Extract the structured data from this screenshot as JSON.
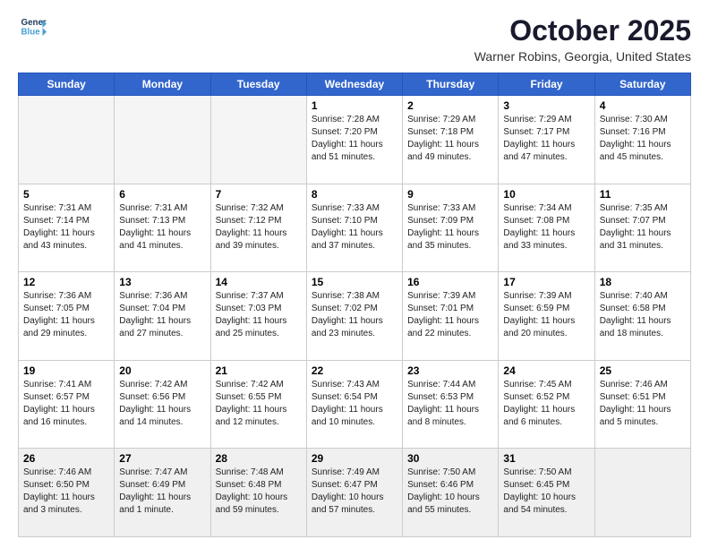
{
  "logo": {
    "line1": "General",
    "line2": "Blue"
  },
  "header": {
    "month": "October 2025",
    "location": "Warner Robins, Georgia, United States"
  },
  "weekdays": [
    "Sunday",
    "Monday",
    "Tuesday",
    "Wednesday",
    "Thursday",
    "Friday",
    "Saturday"
  ],
  "weeks": [
    [
      {
        "day": "",
        "sunrise": "",
        "sunset": "",
        "daylight": ""
      },
      {
        "day": "",
        "sunrise": "",
        "sunset": "",
        "daylight": ""
      },
      {
        "day": "",
        "sunrise": "",
        "sunset": "",
        "daylight": ""
      },
      {
        "day": "1",
        "sunrise": "Sunrise: 7:28 AM",
        "sunset": "Sunset: 7:20 PM",
        "daylight": "Daylight: 11 hours and 51 minutes."
      },
      {
        "day": "2",
        "sunrise": "Sunrise: 7:29 AM",
        "sunset": "Sunset: 7:18 PM",
        "daylight": "Daylight: 11 hours and 49 minutes."
      },
      {
        "day": "3",
        "sunrise": "Sunrise: 7:29 AM",
        "sunset": "Sunset: 7:17 PM",
        "daylight": "Daylight: 11 hours and 47 minutes."
      },
      {
        "day": "4",
        "sunrise": "Sunrise: 7:30 AM",
        "sunset": "Sunset: 7:16 PM",
        "daylight": "Daylight: 11 hours and 45 minutes."
      }
    ],
    [
      {
        "day": "5",
        "sunrise": "Sunrise: 7:31 AM",
        "sunset": "Sunset: 7:14 PM",
        "daylight": "Daylight: 11 hours and 43 minutes."
      },
      {
        "day": "6",
        "sunrise": "Sunrise: 7:31 AM",
        "sunset": "Sunset: 7:13 PM",
        "daylight": "Daylight: 11 hours and 41 minutes."
      },
      {
        "day": "7",
        "sunrise": "Sunrise: 7:32 AM",
        "sunset": "Sunset: 7:12 PM",
        "daylight": "Daylight: 11 hours and 39 minutes."
      },
      {
        "day": "8",
        "sunrise": "Sunrise: 7:33 AM",
        "sunset": "Sunset: 7:10 PM",
        "daylight": "Daylight: 11 hours and 37 minutes."
      },
      {
        "day": "9",
        "sunrise": "Sunrise: 7:33 AM",
        "sunset": "Sunset: 7:09 PM",
        "daylight": "Daylight: 11 hours and 35 minutes."
      },
      {
        "day": "10",
        "sunrise": "Sunrise: 7:34 AM",
        "sunset": "Sunset: 7:08 PM",
        "daylight": "Daylight: 11 hours and 33 minutes."
      },
      {
        "day": "11",
        "sunrise": "Sunrise: 7:35 AM",
        "sunset": "Sunset: 7:07 PM",
        "daylight": "Daylight: 11 hours and 31 minutes."
      }
    ],
    [
      {
        "day": "12",
        "sunrise": "Sunrise: 7:36 AM",
        "sunset": "Sunset: 7:05 PM",
        "daylight": "Daylight: 11 hours and 29 minutes."
      },
      {
        "day": "13",
        "sunrise": "Sunrise: 7:36 AM",
        "sunset": "Sunset: 7:04 PM",
        "daylight": "Daylight: 11 hours and 27 minutes."
      },
      {
        "day": "14",
        "sunrise": "Sunrise: 7:37 AM",
        "sunset": "Sunset: 7:03 PM",
        "daylight": "Daylight: 11 hours and 25 minutes."
      },
      {
        "day": "15",
        "sunrise": "Sunrise: 7:38 AM",
        "sunset": "Sunset: 7:02 PM",
        "daylight": "Daylight: 11 hours and 23 minutes."
      },
      {
        "day": "16",
        "sunrise": "Sunrise: 7:39 AM",
        "sunset": "Sunset: 7:01 PM",
        "daylight": "Daylight: 11 hours and 22 minutes."
      },
      {
        "day": "17",
        "sunrise": "Sunrise: 7:39 AM",
        "sunset": "Sunset: 6:59 PM",
        "daylight": "Daylight: 11 hours and 20 minutes."
      },
      {
        "day": "18",
        "sunrise": "Sunrise: 7:40 AM",
        "sunset": "Sunset: 6:58 PM",
        "daylight": "Daylight: 11 hours and 18 minutes."
      }
    ],
    [
      {
        "day": "19",
        "sunrise": "Sunrise: 7:41 AM",
        "sunset": "Sunset: 6:57 PM",
        "daylight": "Daylight: 11 hours and 16 minutes."
      },
      {
        "day": "20",
        "sunrise": "Sunrise: 7:42 AM",
        "sunset": "Sunset: 6:56 PM",
        "daylight": "Daylight: 11 hours and 14 minutes."
      },
      {
        "day": "21",
        "sunrise": "Sunrise: 7:42 AM",
        "sunset": "Sunset: 6:55 PM",
        "daylight": "Daylight: 11 hours and 12 minutes."
      },
      {
        "day": "22",
        "sunrise": "Sunrise: 7:43 AM",
        "sunset": "Sunset: 6:54 PM",
        "daylight": "Daylight: 11 hours and 10 minutes."
      },
      {
        "day": "23",
        "sunrise": "Sunrise: 7:44 AM",
        "sunset": "Sunset: 6:53 PM",
        "daylight": "Daylight: 11 hours and 8 minutes."
      },
      {
        "day": "24",
        "sunrise": "Sunrise: 7:45 AM",
        "sunset": "Sunset: 6:52 PM",
        "daylight": "Daylight: 11 hours and 6 minutes."
      },
      {
        "day": "25",
        "sunrise": "Sunrise: 7:46 AM",
        "sunset": "Sunset: 6:51 PM",
        "daylight": "Daylight: 11 hours and 5 minutes."
      }
    ],
    [
      {
        "day": "26",
        "sunrise": "Sunrise: 7:46 AM",
        "sunset": "Sunset: 6:50 PM",
        "daylight": "Daylight: 11 hours and 3 minutes."
      },
      {
        "day": "27",
        "sunrise": "Sunrise: 7:47 AM",
        "sunset": "Sunset: 6:49 PM",
        "daylight": "Daylight: 11 hours and 1 minute."
      },
      {
        "day": "28",
        "sunrise": "Sunrise: 7:48 AM",
        "sunset": "Sunset: 6:48 PM",
        "daylight": "Daylight: 10 hours and 59 minutes."
      },
      {
        "day": "29",
        "sunrise": "Sunrise: 7:49 AM",
        "sunset": "Sunset: 6:47 PM",
        "daylight": "Daylight: 10 hours and 57 minutes."
      },
      {
        "day": "30",
        "sunrise": "Sunrise: 7:50 AM",
        "sunset": "Sunset: 6:46 PM",
        "daylight": "Daylight: 10 hours and 55 minutes."
      },
      {
        "day": "31",
        "sunrise": "Sunrise: 7:50 AM",
        "sunset": "Sunset: 6:45 PM",
        "daylight": "Daylight: 10 hours and 54 minutes."
      },
      {
        "day": "",
        "sunrise": "",
        "sunset": "",
        "daylight": ""
      }
    ]
  ]
}
